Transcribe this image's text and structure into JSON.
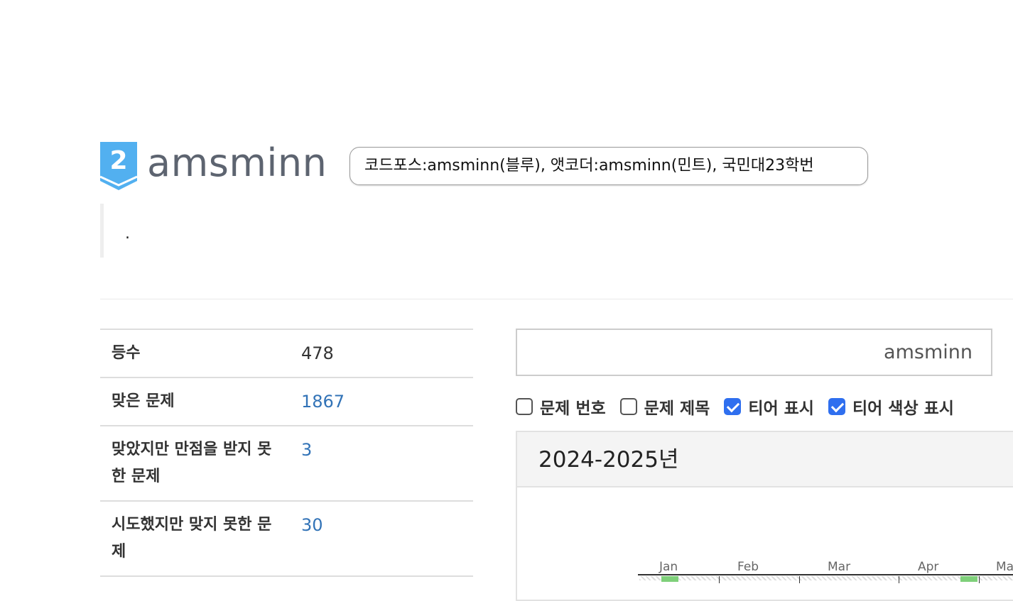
{
  "profile": {
    "tier_badge_number": "2",
    "tier_color": "#52b0f0",
    "username": "amsminn",
    "bio": "코드포스:amsminn(블루), 앳코더:amsminn(민트), 국민대23학번",
    "status_message": "."
  },
  "stats": [
    {
      "key": "등수",
      "value": "478",
      "link": false
    },
    {
      "key": "맞은 문제",
      "value": "1867",
      "link": true
    },
    {
      "key": "맞았지만 만점을 받지 못한 문제",
      "value": "3",
      "link": true
    },
    {
      "key": "시도했지만 맞지 못한 문제",
      "value": "30",
      "link": true
    }
  ],
  "search": {
    "value": "amsminn"
  },
  "options": [
    {
      "label": "문제 번호",
      "checked": false
    },
    {
      "label": "문제 제목",
      "checked": false
    },
    {
      "label": "티어 표시",
      "checked": true
    },
    {
      "label": "티어 색상 표시",
      "checked": true
    }
  ],
  "heatmap": {
    "title": "2024-2025년",
    "months": [
      "Jan",
      "Feb",
      "Mar",
      "Apr",
      "Ma"
    ]
  },
  "colors": {
    "link": "#3273b7",
    "checkbox": "#2f6fef",
    "accent_green": "#7fd07a"
  }
}
